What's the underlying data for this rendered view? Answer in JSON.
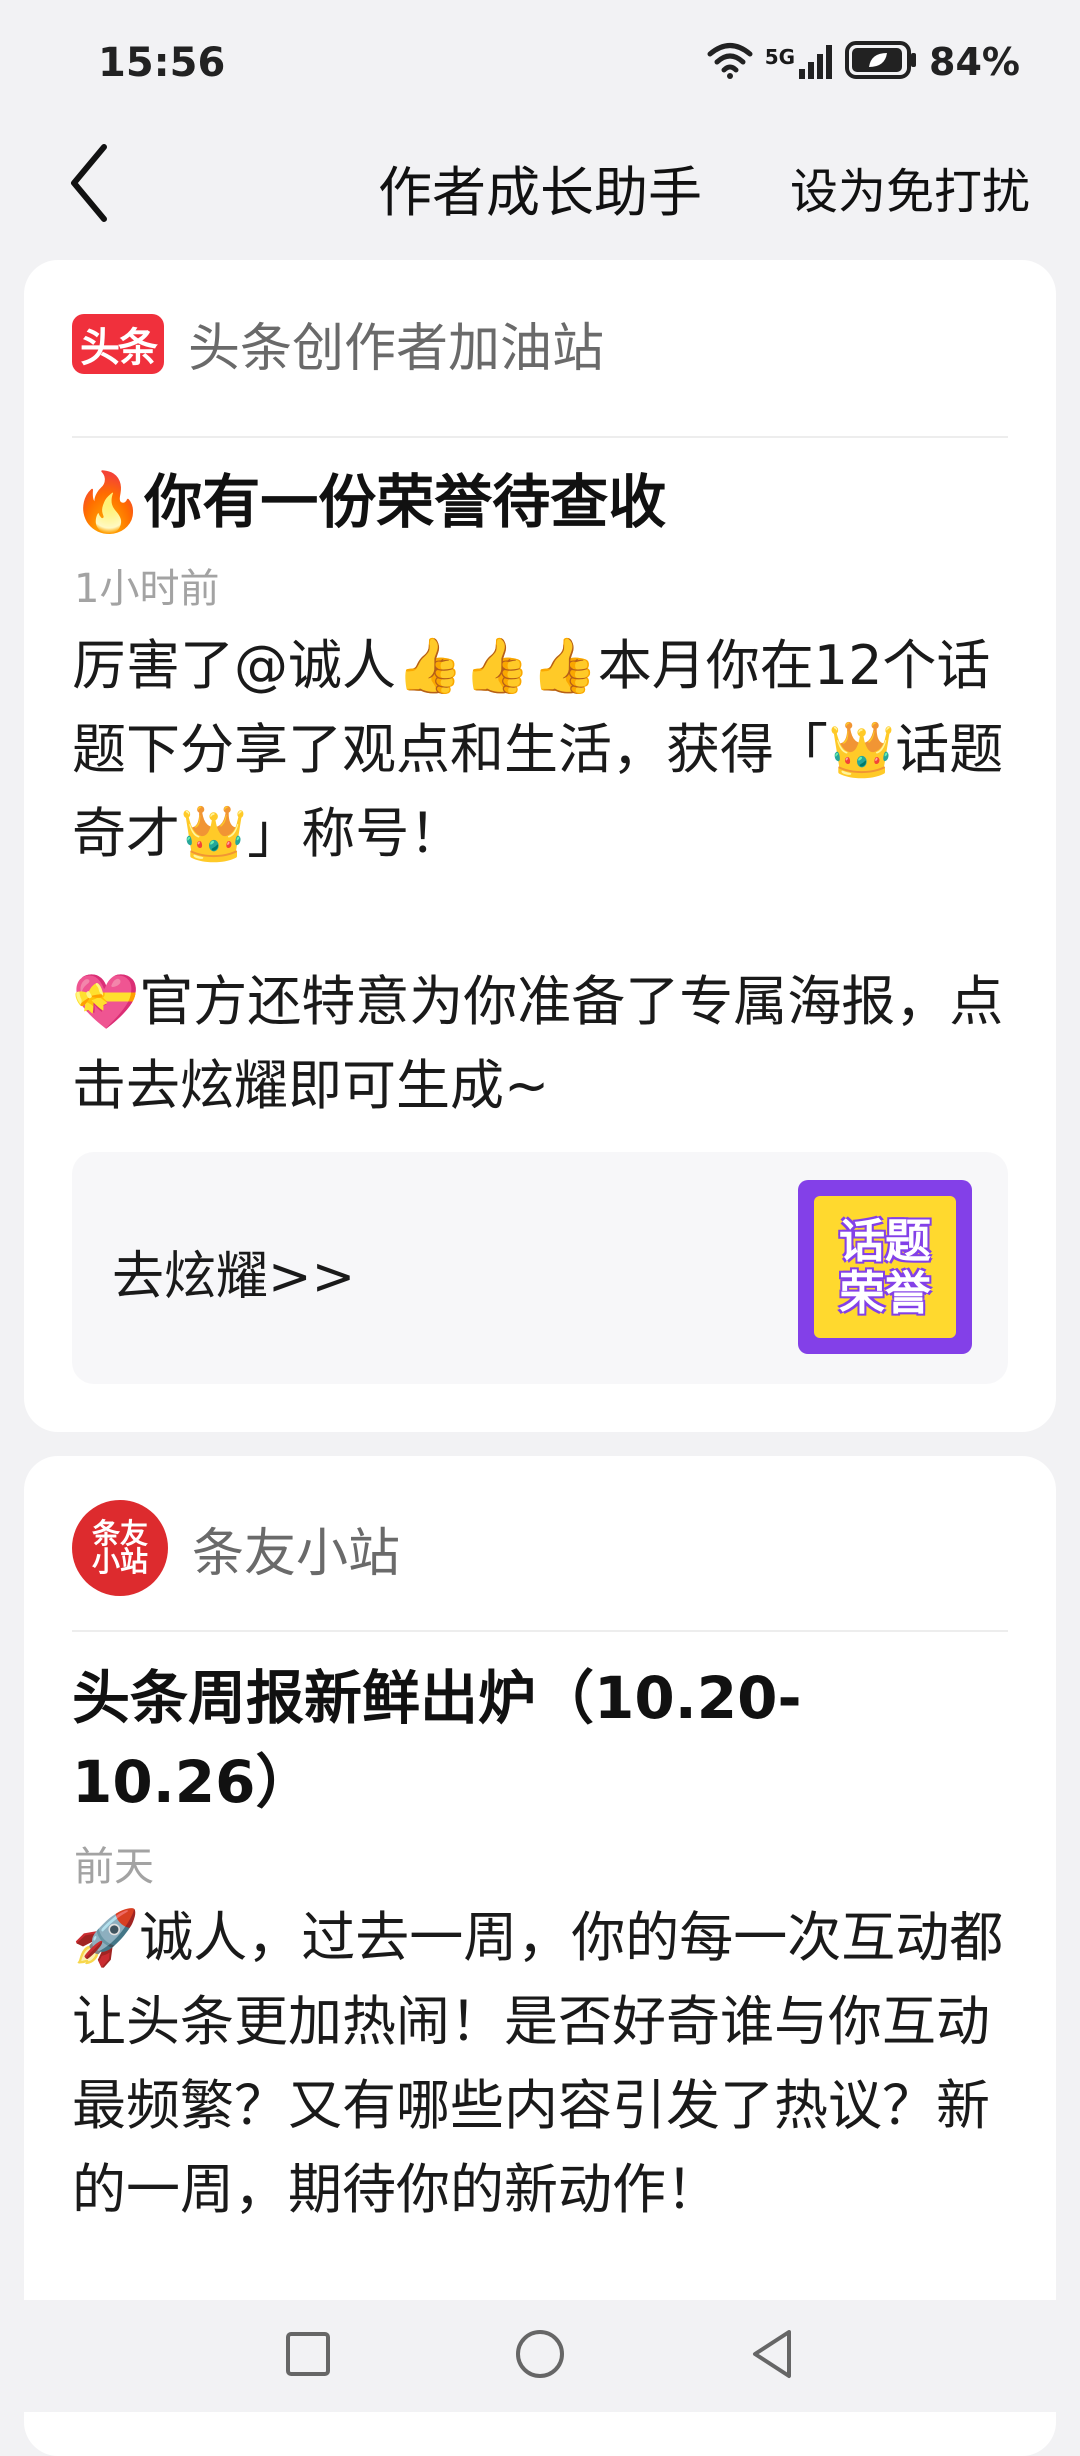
{
  "status_bar": {
    "time": "15:56",
    "network": "5G",
    "battery": "84%"
  },
  "header": {
    "title": "作者成长助手",
    "dnd_label": "设为免打扰"
  },
  "cards": [
    {
      "source_logo_text": "头条",
      "source_name": "头条创作者加油站",
      "title": "🔥你有一份荣誉待查收",
      "time": "1小时前",
      "body": "厉害了@诚人👍👍👍本月你在12个话题下分享了观点和生活，获得「👑话题奇才👑」称号！\n\n💝官方还特意为你准备了专属海报，点击去炫耀即可生成~",
      "action_label": "去炫耀>>",
      "badge_line1": "话题",
      "badge_line2": "荣誉"
    },
    {
      "source_logo_text": "条友小站",
      "source_name": "条友小站",
      "title": "头条周报新鲜出炉（10.20-10.26）",
      "time": "前天",
      "body": "🚀诚人，过去一周，你的每一次互动都让头条更加热闹！是否好奇谁与你互动最频繁？又有哪些内容引发了热议？新的一周，期待你的新动作！"
    }
  ],
  "icons": {
    "back": "chevron-left-icon",
    "wifi": "wifi-icon",
    "signal": "signal-icon",
    "battery": "battery-icon",
    "nav_recent": "square-icon",
    "nav_home": "circle-icon",
    "nav_back": "triangle-back-icon"
  },
  "colors": {
    "brand_red": "#f0303c",
    "badge_purple": "#8340e8",
    "badge_yellow": "#ffd92e"
  }
}
